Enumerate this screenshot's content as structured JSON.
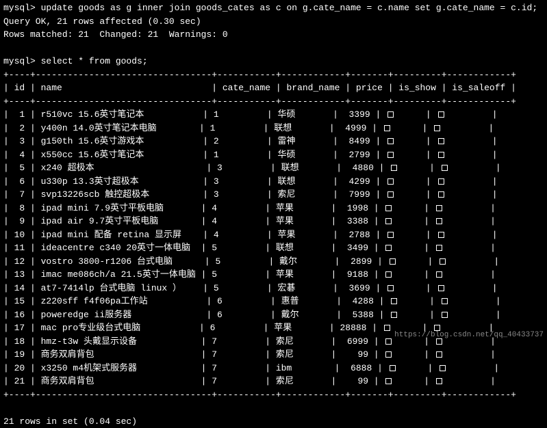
{
  "prompt1": "mysql> update goods as g inner join goods_cates as c on g.cate_name = c.name set g.cate_name = c.id;",
  "result1": "Query OK, 21 rows affected (0.30 sec)",
  "result2": "Rows matched: 21  Changed: 21  Warnings: 0",
  "prompt2": "mysql> select * from goods;",
  "headers": {
    "id": "id",
    "name": "name",
    "cate_name": "cate_name",
    "brand_name": "brand_name",
    "price": "price",
    "is_show": "is_show",
    "is_saleoff": "is_saleoff"
  },
  "rows": [
    {
      "id": "1",
      "name": "r510vc 15.6英寸笔记本",
      "cate_name": "1",
      "brand_name": "华硕",
      "price": "3399"
    },
    {
      "id": "2",
      "name": "y400n 14.0英寸笔记本电脑",
      "cate_name": "1",
      "brand_name": "联想",
      "price": "4999"
    },
    {
      "id": "3",
      "name": "g150th 15.6英寸游戏本",
      "cate_name": "2",
      "brand_name": "雷神",
      "price": "8499"
    },
    {
      "id": "4",
      "name": "x550cc 15.6英寸笔记本",
      "cate_name": "1",
      "brand_name": "华硕",
      "price": "2799"
    },
    {
      "id": "5",
      "name": "x240 超极本",
      "cate_name": "3",
      "brand_name": "联想",
      "price": "4880"
    },
    {
      "id": "6",
      "name": "u330p 13.3英寸超极本",
      "cate_name": "3",
      "brand_name": "联想",
      "price": "4299"
    },
    {
      "id": "7",
      "name": "svp13226scb 触控超极本",
      "cate_name": "3",
      "brand_name": "索尼",
      "price": "7999"
    },
    {
      "id": "8",
      "name": "ipad mini 7.9英寸平板电脑",
      "cate_name": "4",
      "brand_name": "苹果",
      "price": "1998"
    },
    {
      "id": "9",
      "name": "ipad air 9.7英寸平板电脑",
      "cate_name": "4",
      "brand_name": "苹果",
      "price": "3388"
    },
    {
      "id": "10",
      "name": "ipad mini 配备 retina 显示屏",
      "cate_name": "4",
      "brand_name": "苹果",
      "price": "2788"
    },
    {
      "id": "11",
      "name": "ideacentre c340 20英寸一体电脑",
      "cate_name": "5",
      "brand_name": "联想",
      "price": "3499"
    },
    {
      "id": "12",
      "name": "vostro 3800-r1206 台式电脑",
      "cate_name": "5",
      "brand_name": "戴尔",
      "price": "2899"
    },
    {
      "id": "13",
      "name": "imac me086ch/a 21.5英寸一体电脑",
      "cate_name": "5",
      "brand_name": "苹果",
      "price": "9188"
    },
    {
      "id": "14",
      "name": "at7-7414lp 台式电脑 linux ）",
      "cate_name": "5",
      "brand_name": "宏碁",
      "price": "3699"
    },
    {
      "id": "15",
      "name": "z220sff f4f06pa工作站",
      "cate_name": "6",
      "brand_name": "惠普",
      "price": "4288"
    },
    {
      "id": "16",
      "name": "poweredge ii服务器",
      "cate_name": "6",
      "brand_name": "戴尔",
      "price": "5388"
    },
    {
      "id": "17",
      "name": "mac pro专业级台式电脑",
      "cate_name": "6",
      "brand_name": "苹果",
      "price": "28888"
    },
    {
      "id": "18",
      "name": "hmz-t3w 头戴显示设备",
      "cate_name": "7",
      "brand_name": "索尼",
      "price": "6999"
    },
    {
      "id": "19",
      "name": "商务双肩背包",
      "cate_name": "7",
      "brand_name": "索尼",
      "price": "99"
    },
    {
      "id": "20",
      "name": "x3250 m4机架式服务器",
      "cate_name": "7",
      "brand_name": "ibm",
      "price": "6888"
    },
    {
      "id": "21",
      "name": "商务双肩背包",
      "cate_name": "7",
      "brand_name": "索尼",
      "price": "99"
    }
  ],
  "footer": "21 rows in set (0.04 sec)",
  "watermark": "https://blog.csdn.net/qq_40433737",
  "border_top": "+----+---------------------------------+-----------+------------+-------+---------+------------+",
  "border_mid": "+----+---------------------------------+-----------+------------+-------+---------+------------+"
}
